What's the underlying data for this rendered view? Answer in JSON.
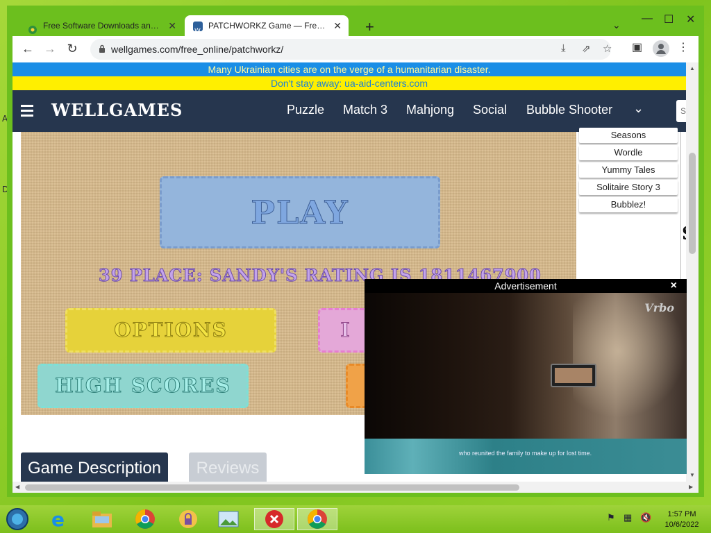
{
  "desktop": {
    "marks": [
      "A",
      "D"
    ]
  },
  "browser": {
    "tabs": [
      {
        "title": "Free Software Downloads and Re",
        "active": false
      },
      {
        "title": "PATCHWORKZ Game — Free Onl",
        "active": true
      }
    ],
    "new_tab_glyph": "+",
    "tab_menu_glyph": "⌄",
    "window_controls": {
      "minimize": "—",
      "maximize": "☐",
      "close": "✕"
    },
    "nav": {
      "back": "←",
      "forward": "→",
      "reload": "↻"
    },
    "url": "wellgames.com/free_online/patchworkz/",
    "toolbar_icons": [
      "install-icon",
      "share-icon",
      "star-icon",
      "side-panel-icon",
      "profile-icon",
      "menu-icon"
    ],
    "menu_glyph": "⋮"
  },
  "page": {
    "banner_line1": "Many Ukrainian cities are on the verge of a humanitarian disaster.",
    "banner_line2": "Don't stay away: ua-aid-centers.com",
    "logo": "WELLGAMES",
    "nav_links": [
      "Puzzle",
      "Match 3",
      "Mahjong",
      "Social",
      "Bubble Shooter"
    ],
    "nav_more": "⌄",
    "search_placeholder": "S",
    "game": {
      "play": "PLAY",
      "rating": "39 PLACE: SANDY'S RATING IS 1811467900",
      "options": "OPTIONS",
      "high_scores": "HIGH SCORES",
      "pink_partial": "I"
    },
    "side_games": [
      "Seasons",
      "Wordle",
      "Yummy Tales",
      "Solitaire Story 3",
      "Bubblez!"
    ],
    "edge_glyph": "S",
    "tabs": {
      "description": "Game Description",
      "reviews": "Reviews"
    }
  },
  "ad": {
    "header": "Advertisement",
    "close": "×",
    "brand": "Vrbo",
    "caption": "who reunited the family to make up for lost time."
  },
  "taskbar": {
    "time": "1:57 PM",
    "date": "10/6/2022",
    "apps": [
      "start-orb",
      "internet-explorer",
      "file-explorer",
      "chrome",
      "keepass",
      "photo-viewer",
      "red-x-app",
      "chrome-active"
    ]
  }
}
